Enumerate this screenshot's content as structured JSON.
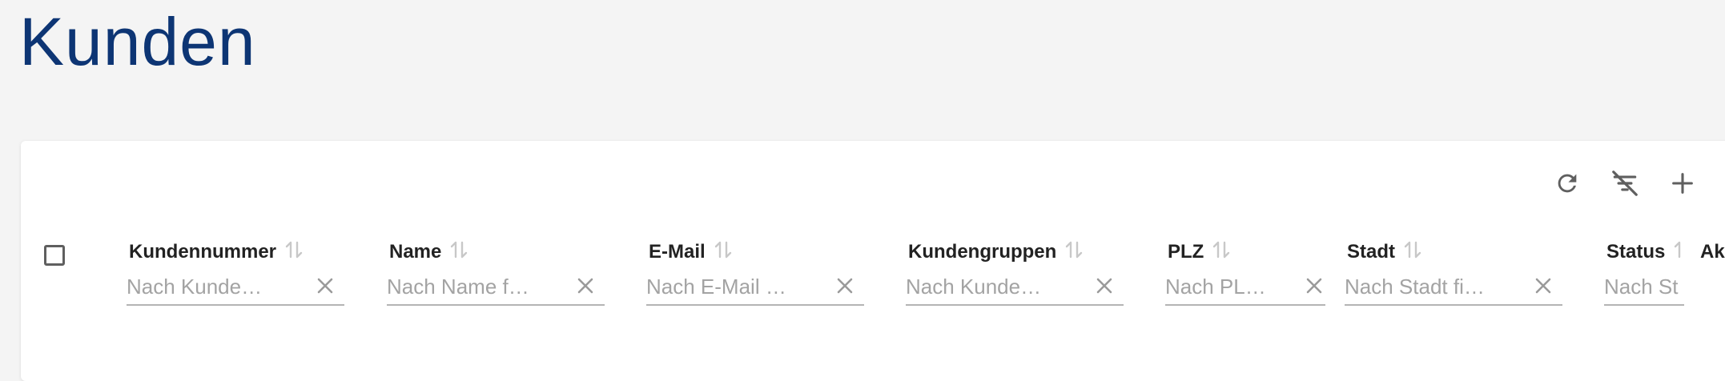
{
  "page": {
    "title": "Kunden"
  },
  "toolbar": {
    "refresh_icon": "refresh-icon",
    "clear_filters_icon": "filter-off-icon",
    "add_icon": "plus-icon",
    "more_icon": "more-vert-icon"
  },
  "table": {
    "columns": [
      {
        "key": "kundennummer",
        "label": "Kundennummer",
        "placeholder": "Nach Kunde…"
      },
      {
        "key": "name",
        "label": "Name",
        "placeholder": "Nach Name f…"
      },
      {
        "key": "email",
        "label": "E-Mail",
        "placeholder": "Nach E-Mail …"
      },
      {
        "key": "kundengruppen",
        "label": "Kundengruppen",
        "placeholder": "Nach Kunde…"
      },
      {
        "key": "plz",
        "label": "PLZ",
        "placeholder": "Nach PL…"
      },
      {
        "key": "stadt",
        "label": "Stadt",
        "placeholder": "Nach Stadt fi…"
      },
      {
        "key": "status",
        "label": "Status",
        "placeholder": "Nach St"
      },
      {
        "key": "aktionen",
        "label": "Ak"
      }
    ]
  },
  "colors": {
    "title": "#0d3574",
    "icon": "#5f5f5f",
    "sort_icon": "#c8c8c8",
    "clear_icon": "#9a9a9a"
  }
}
